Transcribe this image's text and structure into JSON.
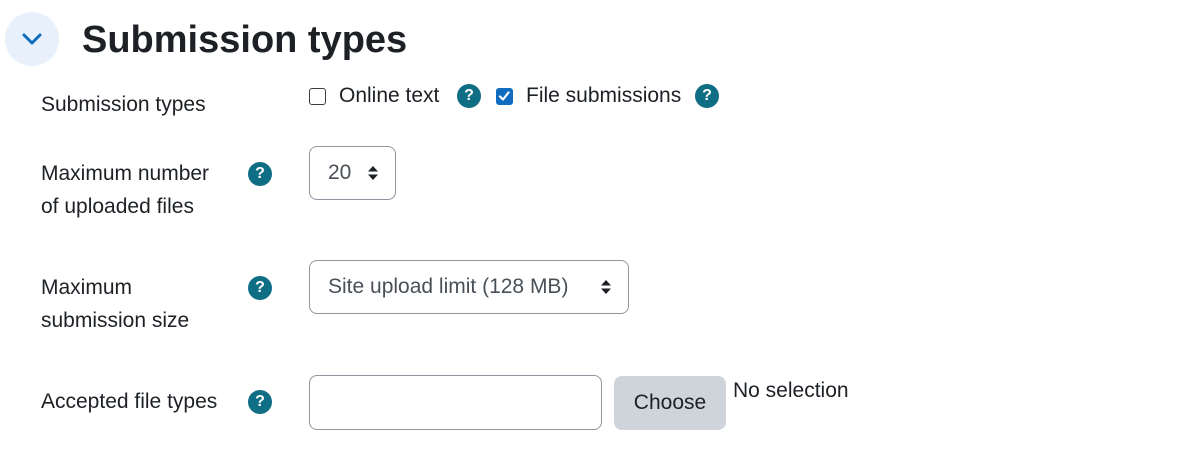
{
  "section": {
    "title": "Submission types",
    "toggle_icon": "chevron-down-icon",
    "accent_color": "#0f6cbf"
  },
  "fields": {
    "submission_types": {
      "label": "Submission types",
      "options": [
        {
          "label": "Online text",
          "checked": false
        },
        {
          "label": "File submissions",
          "checked": true
        }
      ]
    },
    "max_files": {
      "label_line1": "Maximum number",
      "label_line2": "of uploaded files",
      "value": "20"
    },
    "max_size": {
      "label_line1": "Maximum",
      "label_line2": "submission size",
      "value": "Site upload limit (128 MB)"
    },
    "accepted_types": {
      "label": "Accepted file types",
      "input_value": "",
      "choose_label": "Choose",
      "selection_text": "No selection"
    }
  },
  "help_icon": {
    "glyph": "?",
    "color": "#0f6e84"
  }
}
